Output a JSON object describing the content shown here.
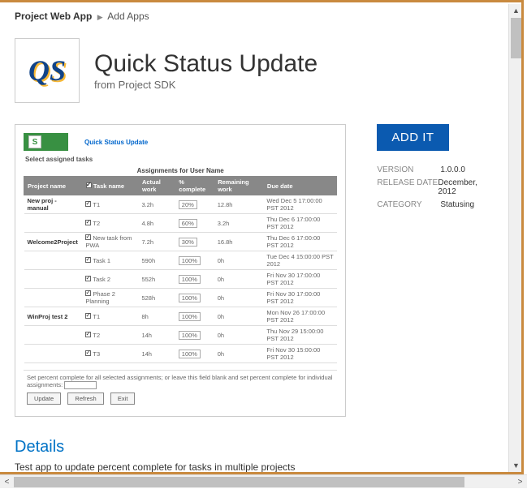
{
  "breadcrumb": {
    "root": "Project Web App",
    "current": "Add Apps"
  },
  "app": {
    "logo_text": "QS",
    "title": "Quick Status Update",
    "subtitle": "from Project SDK"
  },
  "thumb": {
    "link_text": "Quick Status Update",
    "sp_letter": "S",
    "select_label": "Select assigned tasks",
    "table_title": "Assignments for User Name",
    "columns": {
      "c1": "Project name",
      "c2": "Task name",
      "c3": "Actual work",
      "c4": "% complete",
      "c5": "Remaining work",
      "c6": "Due date"
    },
    "rows": [
      {
        "proj": "New proj - manual",
        "task": "T1",
        "checked": true,
        "actual": "3.2h",
        "pct": "20%",
        "rem": "12.8h",
        "due": "Wed Dec 5 17:00:00 PST 2012"
      },
      {
        "proj": "",
        "task": "T2",
        "checked": true,
        "actual": "4.8h",
        "pct": "60%",
        "rem": "3.2h",
        "due": "Thu Dec 6 17:00:00 PST 2012"
      },
      {
        "proj": "Welcome2Project",
        "task": "New task from PWA",
        "checked": true,
        "actual": "7.2h",
        "pct": "30%",
        "rem": "16.8h",
        "due": "Thu Dec 6 17:00:00 PST 2012"
      },
      {
        "proj": "",
        "task": "Task 1",
        "checked": true,
        "actual": "590h",
        "pct": "100%",
        "rem": "0h",
        "due": "Tue Dec 4 15:00:00 PST 2012"
      },
      {
        "proj": "",
        "task": "Task 2",
        "checked": true,
        "actual": "552h",
        "pct": "100%",
        "rem": "0h",
        "due": "Fri Nov 30 17:00:00 PST 2012"
      },
      {
        "proj": "",
        "task": "Phase 2 Planning",
        "checked": true,
        "actual": "528h",
        "pct": "100%",
        "rem": "0h",
        "due": "Fri Nov 30 17:00:00 PST 2012"
      },
      {
        "proj": "WinProj test 2",
        "task": "T1",
        "checked": true,
        "actual": "8h",
        "pct": "100%",
        "rem": "0h",
        "due": "Mon Nov 26 17:00:00 PST 2012"
      },
      {
        "proj": "",
        "task": "T2",
        "checked": true,
        "actual": "14h",
        "pct": "100%",
        "rem": "0h",
        "due": "Thu Nov 29 15:00:00 PST 2012"
      },
      {
        "proj": "",
        "task": "T3",
        "checked": true,
        "actual": "14h",
        "pct": "100%",
        "rem": "0h",
        "due": "Fri Nov 30 15:00:00 PST 2012"
      }
    ],
    "footer_text": "Set percent complete for all selected assignments; or leave this field blank and set percent complete for individual assignments:",
    "btn_update": "Update",
    "btn_refresh": "Refresh",
    "btn_exit": "Exit"
  },
  "side": {
    "add_label": "ADD IT",
    "meta": {
      "version_label": "VERSION",
      "version_value": "1.0.0.0",
      "release_label": "RELEASE DATE",
      "release_value": "December, 2012",
      "category_label": "CATEGORY",
      "category_value": "Statusing"
    }
  },
  "details": {
    "heading": "Details",
    "text": "Test app to update percent complete for tasks in multiple projects"
  }
}
